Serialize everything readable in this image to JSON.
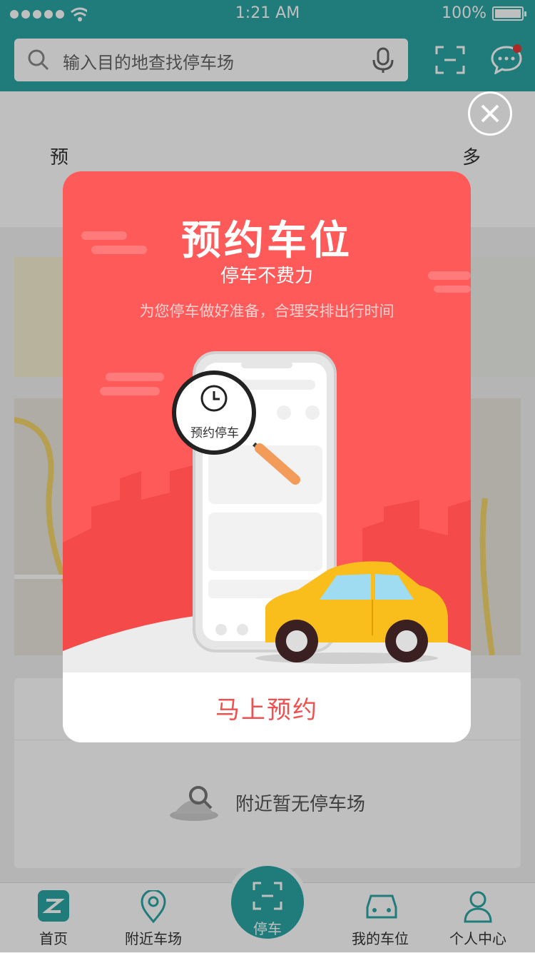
{
  "status_bar": {
    "time": "1:21 AM",
    "battery": "100%"
  },
  "search": {
    "placeholder": "输入目的地查找停车场"
  },
  "quick_menu": {
    "items": [
      "预",
      "多"
    ]
  },
  "nearby": {
    "empty_text": "附近暂无停车场"
  },
  "tabs": [
    {
      "label": "首页",
      "icon": "home-icon"
    },
    {
      "label": "附近车场",
      "icon": "location-pin-icon"
    },
    {
      "label": "停车",
      "icon": "scan-icon"
    },
    {
      "label": "我的车位",
      "icon": "car-icon"
    },
    {
      "label": "个人中心",
      "icon": "person-icon"
    }
  ],
  "modal": {
    "title": "预约车位",
    "subtitle": "停车不费力",
    "description": "为您停车做好准备，合理安排出行时间",
    "lens_label": "预约停车",
    "action_label": "马上预约"
  },
  "colors": {
    "primary": "#2ba6a4",
    "modal_red": "#fe5a5a",
    "action_text": "#f0504f"
  }
}
